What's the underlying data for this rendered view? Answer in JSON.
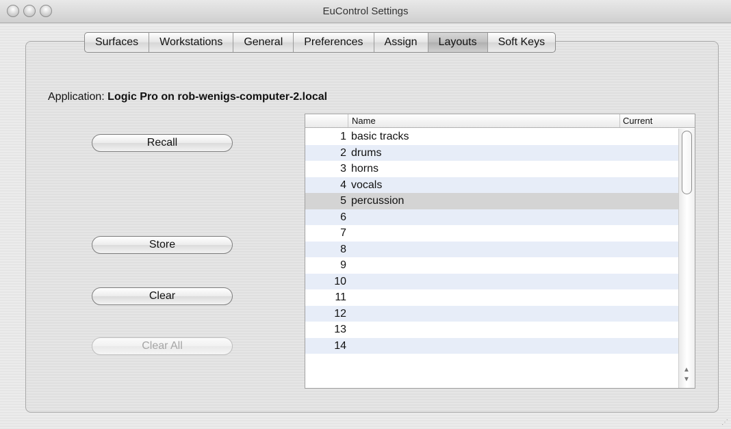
{
  "window": {
    "title": "EuControl Settings"
  },
  "tabs": [
    "Surfaces",
    "Workstations",
    "General",
    "Preferences",
    "Assign",
    "Layouts",
    "Soft Keys"
  ],
  "active_tab": "Layouts",
  "application": {
    "label": "Application:",
    "value": "Logic Pro on rob-wenigs-computer-2.local"
  },
  "buttons": {
    "recall": "Recall",
    "store": "Store",
    "clear": "Clear",
    "clear_all": "Clear All"
  },
  "table": {
    "columns": {
      "name": "Name",
      "current": "Current"
    },
    "rows": [
      {
        "num": "1",
        "name": "basic tracks"
      },
      {
        "num": "2",
        "name": "drums"
      },
      {
        "num": "3",
        "name": "horns"
      },
      {
        "num": "4",
        "name": "vocals"
      },
      {
        "num": "5",
        "name": "percussion"
      },
      {
        "num": "6",
        "name": ""
      },
      {
        "num": "7",
        "name": ""
      },
      {
        "num": "8",
        "name": ""
      },
      {
        "num": "9",
        "name": ""
      },
      {
        "num": "10",
        "name": ""
      },
      {
        "num": "11",
        "name": ""
      },
      {
        "num": "12",
        "name": ""
      },
      {
        "num": "13",
        "name": ""
      },
      {
        "num": "14",
        "name": ""
      }
    ],
    "selected_index": 4
  }
}
